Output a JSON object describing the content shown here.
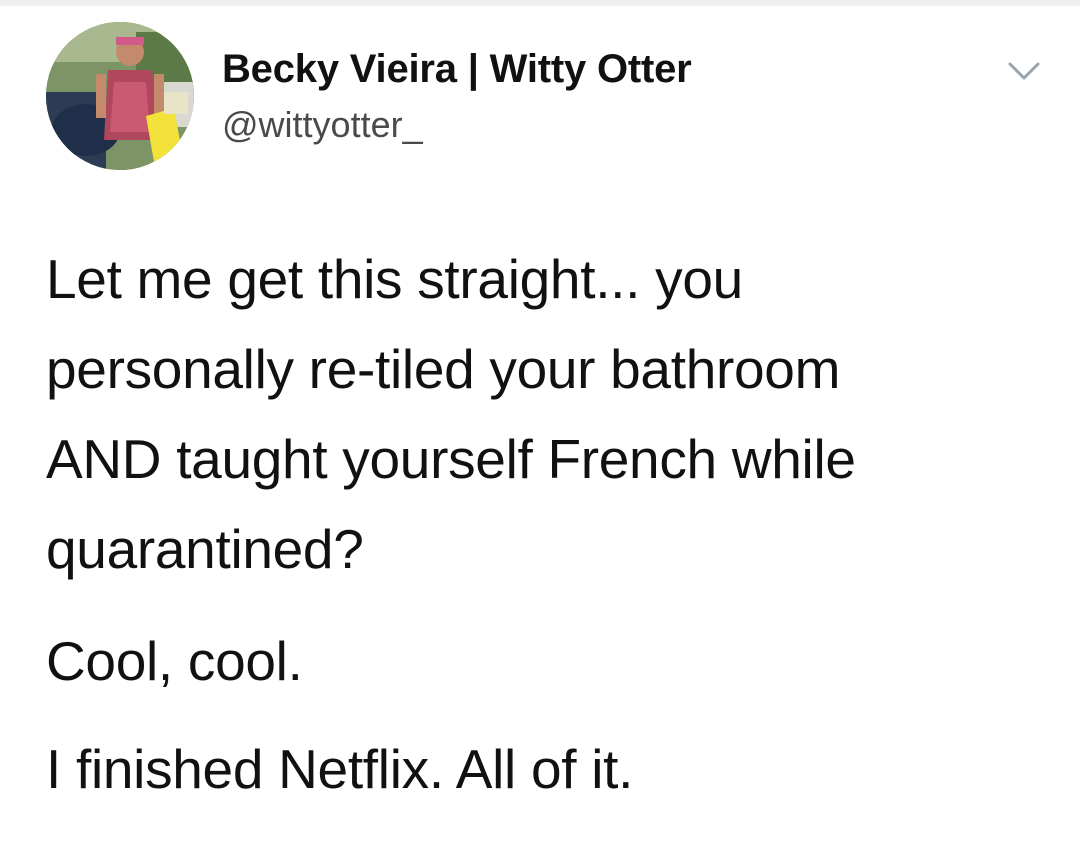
{
  "author": {
    "display_name": "Becky Vieira | Witty Otter",
    "handle": "@wittyotter_"
  },
  "icons": {
    "avatar": "profile-photo",
    "menu": "chevron-down-icon"
  },
  "tweet": {
    "lines": [
      "Let me get this straight... you",
      "personally re-tiled your bathroom",
      "AND taught yourself French while",
      "quarantined?"
    ],
    "line_2": "Cool, cool.",
    "line_3": "I finished Netflix. All of it."
  },
  "colors": {
    "text": "#111111",
    "handle": "#4a4a4a",
    "chevron": "#9aa4ad"
  }
}
